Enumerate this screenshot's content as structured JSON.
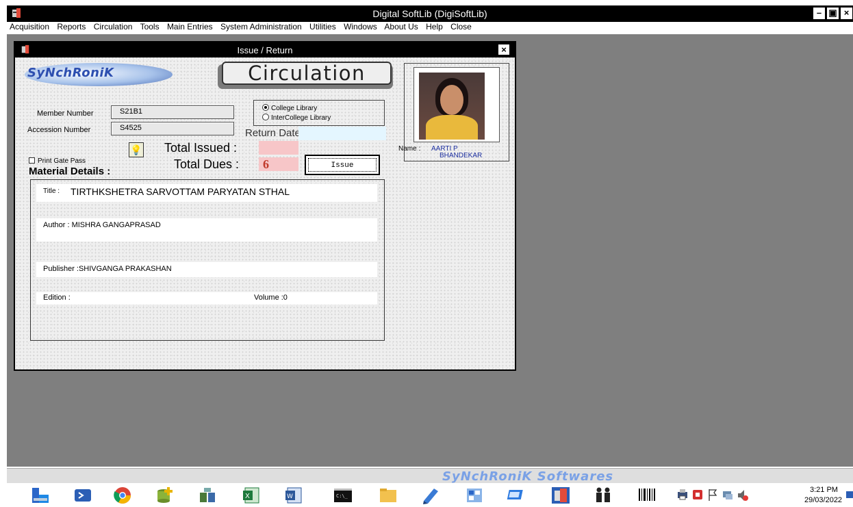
{
  "window": {
    "title": "Digital SoftLib (DigiSoftLib)"
  },
  "menu": [
    "Acquisition",
    "Reports",
    "Circulation",
    "Tools",
    "Main Entries",
    "System Administration",
    "Utilities",
    "Windows",
    "About Us",
    "Help",
    "Close"
  ],
  "dialog": {
    "title": "Issue / Return",
    "logo": "SyNchRoniK",
    "heading": "Circulation",
    "member_label": "Member Number",
    "member_value": "S21B1",
    "accession_label": "Accession Number",
    "accession_value": "S4525",
    "library_options": [
      {
        "label": "College Library",
        "selected": true
      },
      {
        "label": "InterCollege Library",
        "selected": false
      }
    ],
    "return_date_label": "Return Date",
    "return_date_value": "",
    "total_issued_label": "Total Issued :",
    "total_issued_value": "",
    "total_dues_label": "Total Dues :",
    "total_dues_value": "6",
    "issue_button": "Issue",
    "print_gate_pass": "Print Gate Pass",
    "material_header": "Material Details :",
    "material": {
      "title_label": "Title :",
      "title_value": "TIRTHKSHETRA SARVOTTAM PARYATAN STHAL",
      "author": "Author : MISHRA  GANGAPRASAD",
      "publisher": "Publisher :SHIVGANGA PRAKASHAN",
      "edition": "Edition :",
      "volume": "Volume :0"
    },
    "name_label": "Name :",
    "name_line1": "AARTI P",
    "name_line2": "BHANDEKAR"
  },
  "statusbar": {
    "brand": "SyNchRoniK Softwares"
  },
  "taskbar": {
    "time": "3:21 PM",
    "date": "29/03/2022",
    "apps": [
      "file-manager-icon",
      "powershell-icon",
      "chrome-icon",
      "database-plus-icon",
      "network-db-icon",
      "excel-icon",
      "word-icon",
      "cmd-icon",
      "explorer-icon",
      "notes-icon",
      "control-panel-icon",
      "display-icon",
      "softlib-icon",
      "members-icon",
      "barcode-icon"
    ],
    "tray": [
      "printer-icon",
      "antivirus-icon",
      "flag-icon",
      "network-icon",
      "volume-icon"
    ]
  },
  "colors": {
    "titlebar": "#000000",
    "mdi_background": "#7f7f7f",
    "dues_red": "#c0392b",
    "name_blue": "#1c2fa0",
    "brand_blue": "#7aa1e6"
  }
}
